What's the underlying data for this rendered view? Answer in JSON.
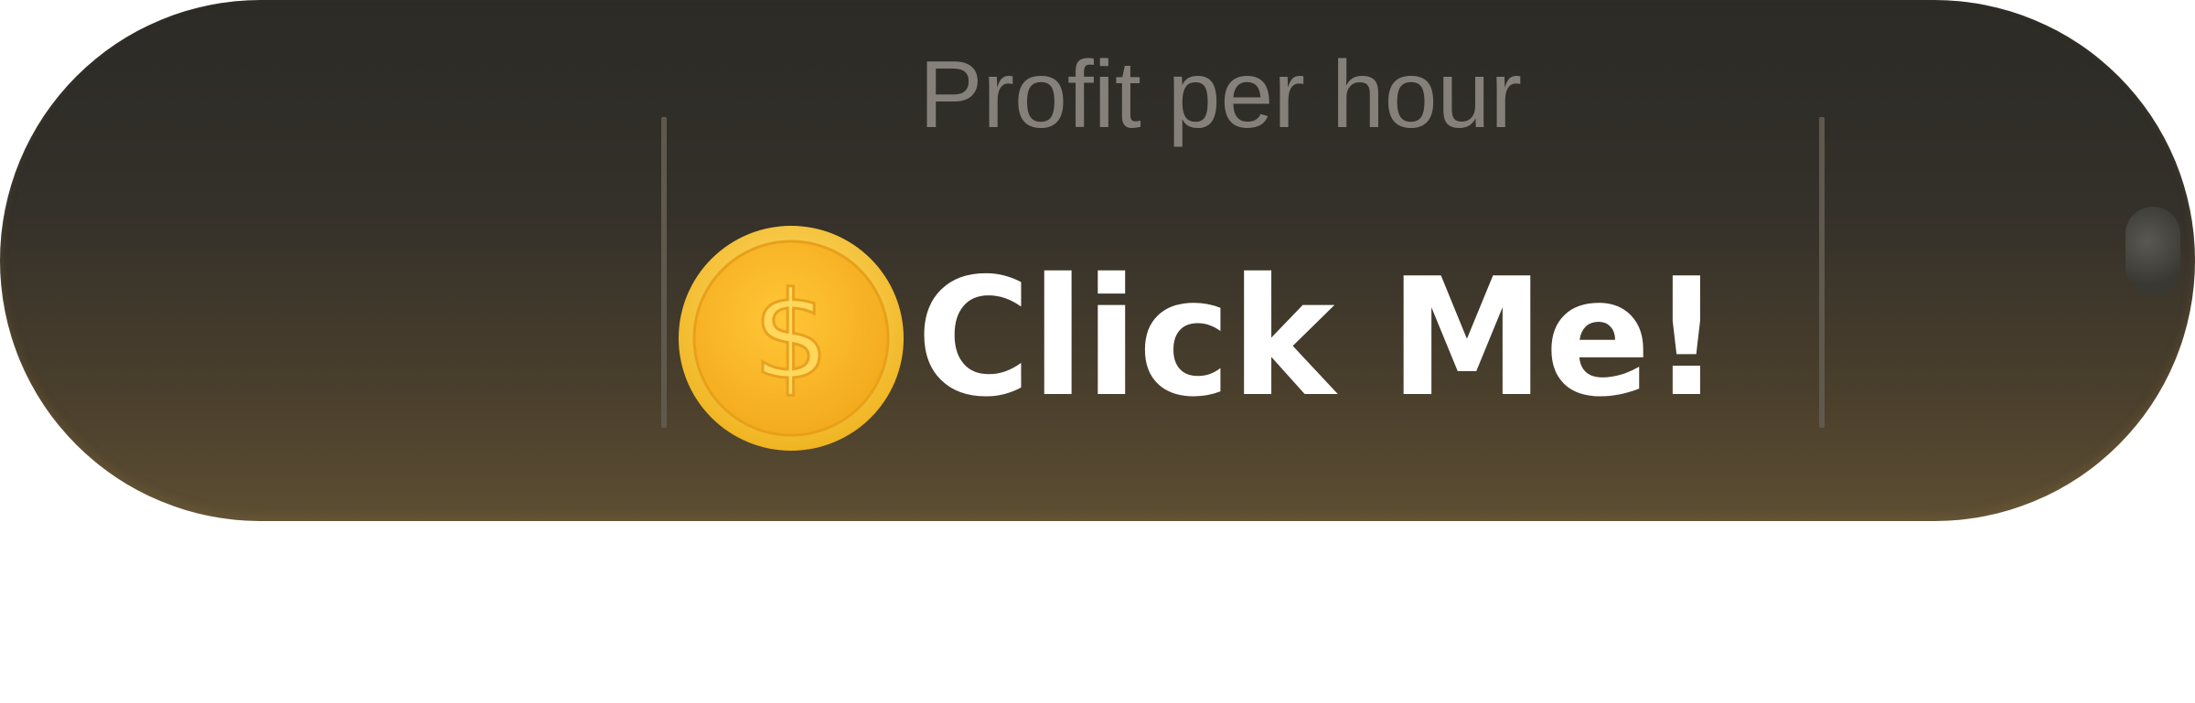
{
  "widget": {
    "label": "Profit per hour",
    "action_text": "Click Me!",
    "coin_symbol": "$"
  },
  "icons": {
    "coin": "gold-coin-icon"
  },
  "colors": {
    "background_top": "#2c2b26",
    "background_bottom": "#5d4e33",
    "label": "#85817a",
    "action_text": "#ffffff",
    "coin": "#f6b21f"
  }
}
